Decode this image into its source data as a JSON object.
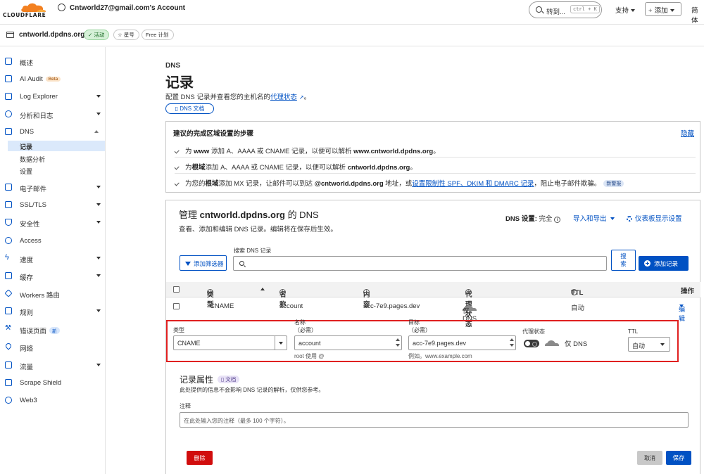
{
  "topbar": {
    "brand": "CLOUDFLARE",
    "account": "Cntworld27@gmail.com's Account",
    "search_label": "转到...",
    "search_shortcut": "ctrl + K",
    "support": "支持",
    "add": "添加",
    "language": "简体"
  },
  "zone": {
    "name": "cntworld.dpdns.org",
    "status": "活动",
    "star": "星号",
    "plan": "Free 计划"
  },
  "sidebar": {
    "items": [
      {
        "label": "概述",
        "icon": "document-icon"
      },
      {
        "label": "AI Audit",
        "icon": "ai-audit-icon",
        "badge": "Beta"
      },
      {
        "label": "Log Explorer",
        "icon": "log-explorer-icon"
      },
      {
        "label": "分析和日志",
        "icon": "analytics-icon"
      },
      {
        "label": "DNS",
        "icon": "dns-icon"
      },
      {
        "label": "电子邮件",
        "icon": "email-icon"
      },
      {
        "label": "SSL/TLS",
        "icon": "lock-icon"
      },
      {
        "label": "安全性",
        "icon": "shield-icon"
      },
      {
        "label": "Access",
        "icon": "access-icon"
      },
      {
        "label": "速度",
        "icon": "lightning-icon"
      },
      {
        "label": "缓存",
        "icon": "cache-icon"
      },
      {
        "label": "Workers 路由",
        "icon": "workers-icon"
      },
      {
        "label": "规则",
        "icon": "rules-icon"
      },
      {
        "label": "错误页面",
        "icon": "wrench-icon",
        "badge": "新"
      },
      {
        "label": "网络",
        "icon": "location-icon"
      },
      {
        "label": "流量",
        "icon": "traffic-icon"
      },
      {
        "label": "Scrape Shield",
        "icon": "scrape-shield-icon"
      },
      {
        "label": "Web3",
        "icon": "web3-icon"
      }
    ],
    "dns_sub": [
      "记录",
      "数据分析",
      "设置"
    ]
  },
  "main": {
    "crumb": "DNS",
    "title": "记录",
    "desc_prefix": "配置 DNS 记录并查看您的主机名的",
    "desc_link": "代理状态",
    "desc_suffix": "。",
    "docs_button": "DNS 文档"
  },
  "steps": {
    "title": "建议的完成区域设置的步骤",
    "hide": "隐藏",
    "s1_a": "为 ",
    "s1_b": "www",
    "s1_c": " 添加 A、AAAA 或 CNAME 记录，以便可以解析 ",
    "s1_d": "www.cntworld.dpdns.org",
    "s1_e": "。",
    "s2_a": "为",
    "s2_b": "根域",
    "s2_c": "添加 A、AAAA 或 CNAME 记录，以便可以解析 ",
    "s2_d": "cntworld.dpdns.org",
    "s2_e": "。",
    "s3_a": "为您的",
    "s3_b": "根域",
    "s3_c": "添加 MX 记录，让邮件可以到达 ",
    "s3_d": "@cntworld.dpdns.org",
    "s3_e": " 地址，或",
    "s3_link": "设置限制性 SPF、DKIM 和 DMARC 记录",
    "s3_f": "，阻止电子邮件欺骗。",
    "s3_badge": "新警报"
  },
  "manage": {
    "title_prefix": "管理 ",
    "title_domain": "cntworld.dpdns.org",
    "title_suffix": " 的 DNS",
    "subtitle": "查看、添加和编辑 DNS 记录。编辑将在保存后生效。",
    "dns_setting_label": "DNS 设置:",
    "dns_setting_value": "完全",
    "import_export": "导入和导出",
    "dashboard_settings": "仪表板显示设置",
    "add_filter": "添加筛选器",
    "search_label": "搜索 DNS 记录",
    "search_button": "搜\n索",
    "search_btn_l1": "搜",
    "search_btn_l2": "索",
    "add_record": "添加记录"
  },
  "table": {
    "headers": {
      "type": "类型",
      "name": "名称",
      "content": "内容",
      "proxy": "代理状态",
      "ttl": "TTL",
      "actions": "操作"
    },
    "rows": [
      {
        "type": "CNAME",
        "name": "account",
        "content": "acc-7e9.pages.dev",
        "proxy": "仅 DNS",
        "ttl": "自动",
        "action": "编辑"
      }
    ]
  },
  "edit": {
    "type_label": "类型",
    "type_value": "CNAME",
    "name_label": "名称",
    "name_req": "（必需）",
    "name_value": "account",
    "name_hint": "root 使用 @",
    "target_label": "目标",
    "target_req": "（必需）",
    "target_value": "acc-7e9.pages.dev",
    "target_hint": "例如。www.example.com",
    "proxy_label": "代理状态",
    "proxy_value": "仅 DNS",
    "proxied": false,
    "ttl_label": "TTL",
    "ttl_value": "自动"
  },
  "attributes": {
    "title": "记录属性",
    "docs": "文档",
    "note": "此处提供的信息不会影响 DNS 记录的解析，仅供您参考。",
    "comment_label": "注释",
    "comment_placeholder": "在此处输入您的注释（最多 100 个字符）。"
  },
  "actions": {
    "delete": "删除",
    "cancel": "取消",
    "save": "保存"
  },
  "colors": {
    "accent": "#0051c3",
    "brand": "#f38020",
    "danger": "#d10d0d",
    "highlight": "#e02020"
  }
}
